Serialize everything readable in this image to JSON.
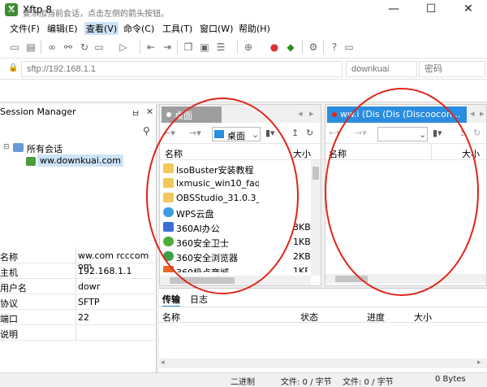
{
  "window": {
    "title": "Xftp 8",
    "minimize": "—",
    "maximize": "☐",
    "close": "✕"
  },
  "menu": [
    "文件(F)",
    "编辑(E)",
    "查看(V)",
    "命令(C)",
    "工具(T)",
    "窗口(W)",
    "帮助(H)"
  ],
  "address": {
    "placeholder": "sftp://192.168.1.1",
    "user_placeholder": "downkuai",
    "password_placeholder": "密码",
    "lock_icon": "🔒"
  },
  "hint": "要添加当前会话，点击左侧的箭头按钮。",
  "session": {
    "title": "Session Manager",
    "pin": "ㅂ",
    "close": "✕",
    "root": "所有会话",
    "child": "ww.downkuai.com",
    "props": [
      {
        "k": "名称",
        "v": "ww.com rcccom om"
      },
      {
        "k": "主机",
        "v": "192.168.1.1"
      },
      {
        "k": "用户名",
        "v": "dowr"
      },
      {
        "k": "协议",
        "v": "SFTP"
      },
      {
        "k": "端口",
        "v": "22"
      },
      {
        "k": "说明",
        "v": ""
      }
    ]
  },
  "local": {
    "tab": "桌面",
    "path": "桌面",
    "col_name": "名称",
    "col_size": "大小",
    "files": [
      {
        "name": "IsoBuster安装教程",
        "size": "",
        "type": "folder"
      },
      {
        "name": "lxmusic_win10_faqd...",
        "size": "",
        "type": "folder"
      },
      {
        "name": "OBSStudio_31.0.3_6...",
        "size": "",
        "type": "folder"
      },
      {
        "name": "WPS云盘",
        "size": "",
        "type": "cloud"
      },
      {
        "name": "360AI办公",
        "size": "3KB",
        "type": "app"
      },
      {
        "name": "360安全卫士",
        "size": "1KB",
        "type": "app"
      },
      {
        "name": "360安全浏览器",
        "size": "2KB",
        "type": "app"
      },
      {
        "name": "360极点商城",
        "size": "1KB",
        "type": "app"
      }
    ]
  },
  "remote": {
    "tab": "ww.i (Dis (Dis (Discoocon...",
    "col_name": "名称",
    "col_size": "大小"
  },
  "transfer": {
    "tabs": [
      "传输",
      "日志"
    ],
    "cols": [
      "名称",
      "状态",
      "进度",
      "大小"
    ]
  },
  "status": {
    "mode": "二进制",
    "files1": "文件: 0 / 字节",
    "files2": "文件: 0 / 字节",
    "speed": "0 Bytes"
  }
}
